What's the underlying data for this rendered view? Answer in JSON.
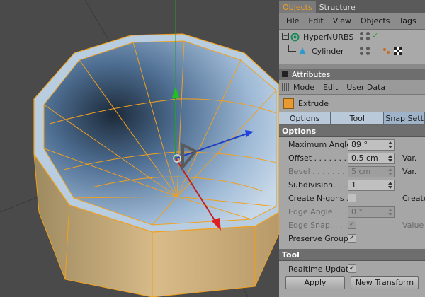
{
  "viewport": {
    "colors": {
      "background": "#4a4a4a",
      "edge": "#f0a020",
      "bowl_inner": "#a8c4dc",
      "bowl_outer": "#c8aa78"
    }
  },
  "panel": {
    "tabs": [
      {
        "label": "Objects",
        "active": true
      },
      {
        "label": "Structure",
        "active": false
      }
    ],
    "menu": [
      "File",
      "Edit",
      "View",
      "Objects",
      "Tags"
    ],
    "objects": [
      {
        "name": "HyperNURBS",
        "icon": "hypernurbs-icon"
      },
      {
        "name": "Cylinder",
        "icon": "cylinder-icon"
      }
    ],
    "attributes_title": "Attributes",
    "attr_menu": [
      "Mode",
      "Edit",
      "User Data"
    ],
    "tool_name": "Extrude",
    "tool_tabs": [
      "Options",
      "Tool",
      "Snap Settings"
    ],
    "options_title": "Options",
    "fields": {
      "max_angle": {
        "label": "Maximum Angle",
        "value": "89 °"
      },
      "offset": {
        "label": "Offset . . . . . . . .",
        "value": "0.5 cm",
        "right": "Var."
      },
      "bevel": {
        "label": "Bevel . . . . . . . .",
        "value": "5 cm",
        "right": "Var."
      },
      "subdivision": {
        "label": "Subdivision. . . .",
        "value": "1"
      },
      "create_ngons": {
        "label": "Create N-gons .",
        "right": "Create"
      },
      "edge_angle": {
        "label": "Edge Angle . . .",
        "value": "0 °"
      },
      "edge_snap": {
        "label": "Edge Snap. . . .",
        "check": "✓",
        "right": "Value"
      },
      "preserve_groups": {
        "label": "Preserve Groups",
        "check": "✓"
      }
    },
    "tool_section_title": "Tool",
    "realtime_update": {
      "label": "Realtime Update",
      "check": "✓"
    },
    "buttons": {
      "apply": "Apply",
      "new_transform": "New Transform"
    }
  }
}
